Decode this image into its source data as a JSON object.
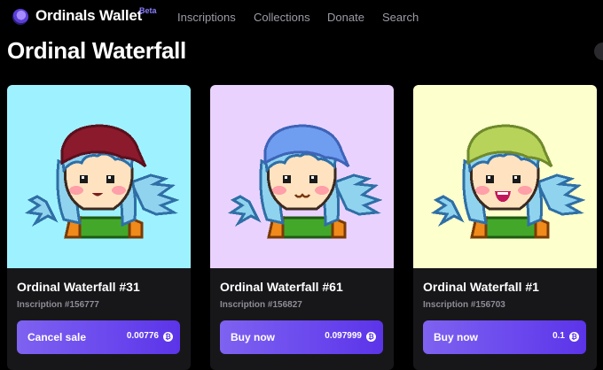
{
  "app": {
    "brand": "Ordinals Wallet",
    "beta": "Beta",
    "nav": [
      "Inscriptions",
      "Collections",
      "Donate",
      "Search"
    ]
  },
  "page": {
    "title": "Ordinal Waterfall"
  },
  "cards": [
    {
      "name": "Ordinal Waterfall #31",
      "inscription": "Inscription #156777",
      "action": "Cancel sale",
      "price": "0.00776",
      "bg": "#9ef2ff",
      "hat": "#8b1a2c",
      "hat_dark": "#5c0f1d",
      "mouth": "smile"
    },
    {
      "name": "Ordinal Waterfall #61",
      "inscription": "Inscription #156827",
      "action": "Buy now",
      "price": "0.097999",
      "bg": "#ead2ff",
      "hat": "#6f9df0",
      "hat_dark": "#3e64b8",
      "mouth": "cat"
    },
    {
      "name": "Ordinal Waterfall #1",
      "inscription": "Inscription #156703",
      "action": "Buy now",
      "price": "0.1",
      "bg": "#fdffcc",
      "hat": "#b7d35a",
      "hat_dark": "#6f8a2c",
      "mouth": "open"
    }
  ],
  "colors": {
    "accent": "#6b49ee",
    "hair": "#8fd3ef",
    "hair_dark": "#2f6fa6",
    "skin": "#ffe2c0",
    "blush": "#ff9fa8",
    "shirt": "#43a82a",
    "jacket": "#f08a1a"
  },
  "icons": {
    "logo": "ordinals-logo-icon",
    "currency": "bitcoin-icon"
  }
}
